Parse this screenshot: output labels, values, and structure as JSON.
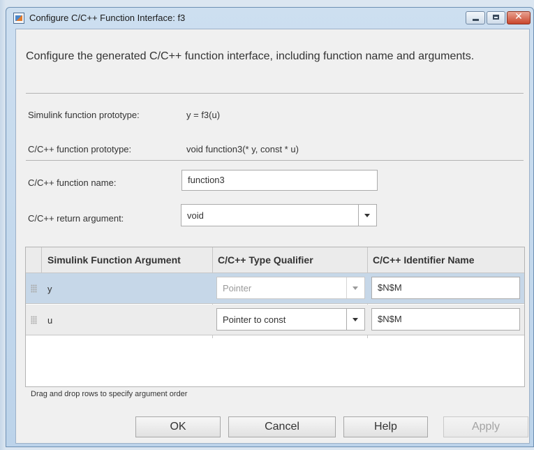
{
  "window": {
    "title": "Configure C/C++ Function Interface: f3",
    "close_glyph": "✕"
  },
  "description": "Configure the generated C/C++ function interface, including function name and arguments.",
  "prototypes": {
    "simulink_label": "Simulink function prototype:",
    "simulink_value": "y = f3(u)",
    "c_label": "C/C++ function prototype:",
    "c_value": "void function3(* y, const * u)"
  },
  "function_name": {
    "label": "C/C++ function name:",
    "value": "function3"
  },
  "return_argument": {
    "label": "C/C++ return argument:",
    "value": "void"
  },
  "table": {
    "headers": [
      "Simulink Function Argument",
      "C/C++ Type Qualifier",
      "C/C++ Identifier Name"
    ],
    "rows": [
      {
        "argument": "y",
        "qualifier": "Pointer",
        "qualifier_enabled": false,
        "identifier": "$N$M",
        "selected": true
      },
      {
        "argument": "u",
        "qualifier": "Pointer to const",
        "qualifier_enabled": true,
        "identifier": "$N$M",
        "selected": false
      }
    ]
  },
  "hint": "Drag and drop rows to specify argument order",
  "buttons": {
    "ok": "OK",
    "cancel": "Cancel",
    "help": "Help",
    "apply": "Apply",
    "apply_enabled": false
  },
  "icons": {
    "app": "simulink-app-icon",
    "minimize": "minimize-icon",
    "maximize": "maximize-icon",
    "close": "close-icon",
    "dropdown": "chevron-down-icon",
    "drag": "drag-handle-icon"
  },
  "colors": {
    "selected_row": "#c6d7e8",
    "close_button": "#c9462c",
    "window_frame": "#bcd3ea"
  }
}
